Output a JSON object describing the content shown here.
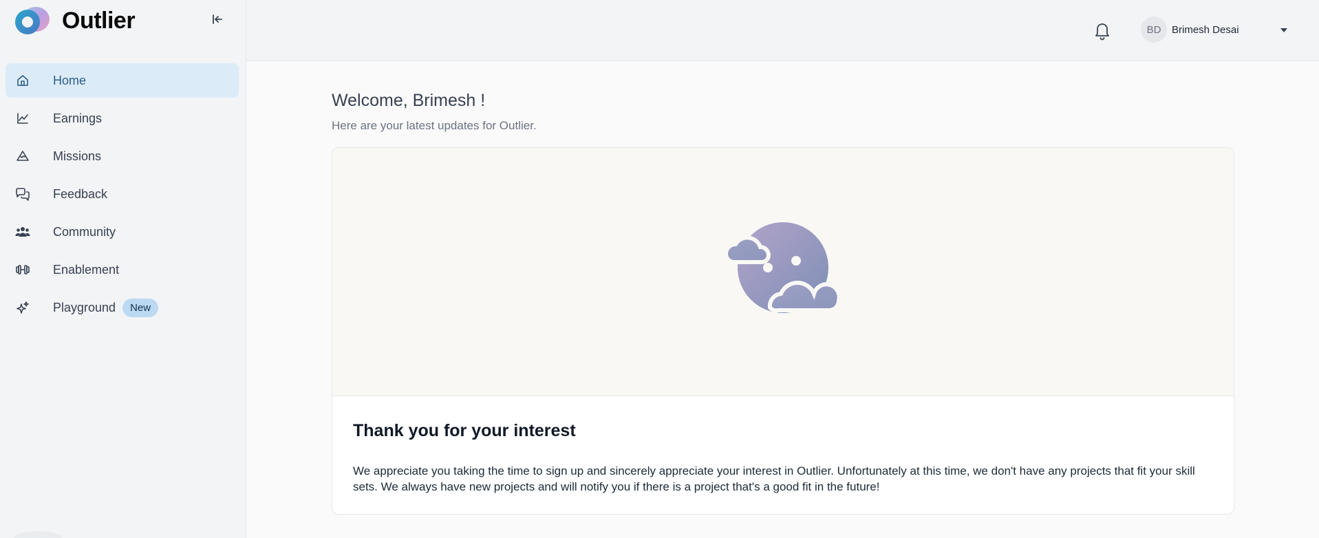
{
  "app": {
    "name": "Outlier"
  },
  "sidebar": {
    "items": [
      {
        "label": "Home",
        "icon": "home-icon",
        "active": true
      },
      {
        "label": "Earnings",
        "icon": "chart-line-icon"
      },
      {
        "label": "Missions",
        "icon": "mountain-icon"
      },
      {
        "label": "Feedback",
        "icon": "chat-bubbles-icon"
      },
      {
        "label": "Community",
        "icon": "users-icon"
      },
      {
        "label": "Enablement",
        "icon": "dumbbell-icon"
      },
      {
        "label": "Playground",
        "icon": "sparkles-icon",
        "badge": "New"
      }
    ]
  },
  "header": {
    "user": {
      "initials": "BD",
      "name": "Brimesh Desai"
    }
  },
  "main": {
    "welcome": "Welcome, Brimesh !",
    "subtitle": "Here are your latest updates for Outlier.",
    "card": {
      "title": "Thank you for your interest",
      "text": "We appreciate you taking the time to sign up and sincerely appreciate your interest in Outlier. Unfortunately at this time, we don't have any projects that fit your skill sets. We always have new projects and will notify you if there is a project that's a good fit in the future!"
    }
  },
  "colors": {
    "active_bg": "#dcebf8",
    "badge_bg": "#bcd9f2",
    "illustration": "#8e9bbd"
  }
}
